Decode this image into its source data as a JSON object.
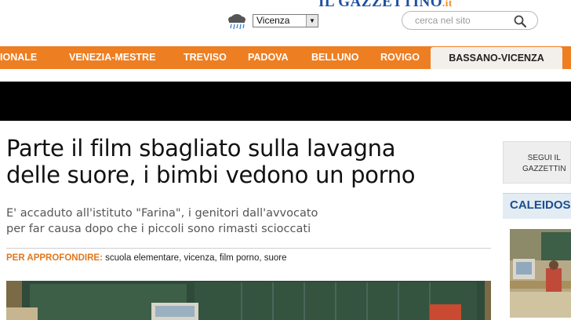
{
  "header": {
    "logo_main": "IL GAZZETTINO",
    "logo_tld": ".it",
    "weather_icon": "rain-cloud-icon",
    "city": "Vicenza",
    "search_placeholder": "cerca nel sito"
  },
  "nav": {
    "items": [
      "IONALE",
      "VENEZIA-MESTRE",
      "TREVISO",
      "PADOVA",
      "BELLUNO",
      "ROVIGO",
      "BASSANO-VICENZA"
    ],
    "active_index": 6
  },
  "article": {
    "headline_line1": "Parte il film sbagliato sulla lavagna",
    "headline_line2": "delle suore, i bimbi vedono un porno",
    "subhead_line1": "E' accaduto all'istituto \"Farina\", i genitori dall'avvocato",
    "subhead_line2": "per far causa dopo che i piccoli sono rimasti scioccati",
    "tags_label": "PER APPROFONDIRE:",
    "tags": [
      "scuola elementare",
      "vicenza",
      "film porno",
      "suore"
    ]
  },
  "sidebar": {
    "follow_line1": "SEGUI IL",
    "follow_line2": "GAZZETTIN",
    "section_title": "CALEIDOS"
  },
  "colors": {
    "nav_orange": "#ee7e22",
    "brand_blue": "#1d4fa0",
    "tag_orange": "#e0781e"
  }
}
